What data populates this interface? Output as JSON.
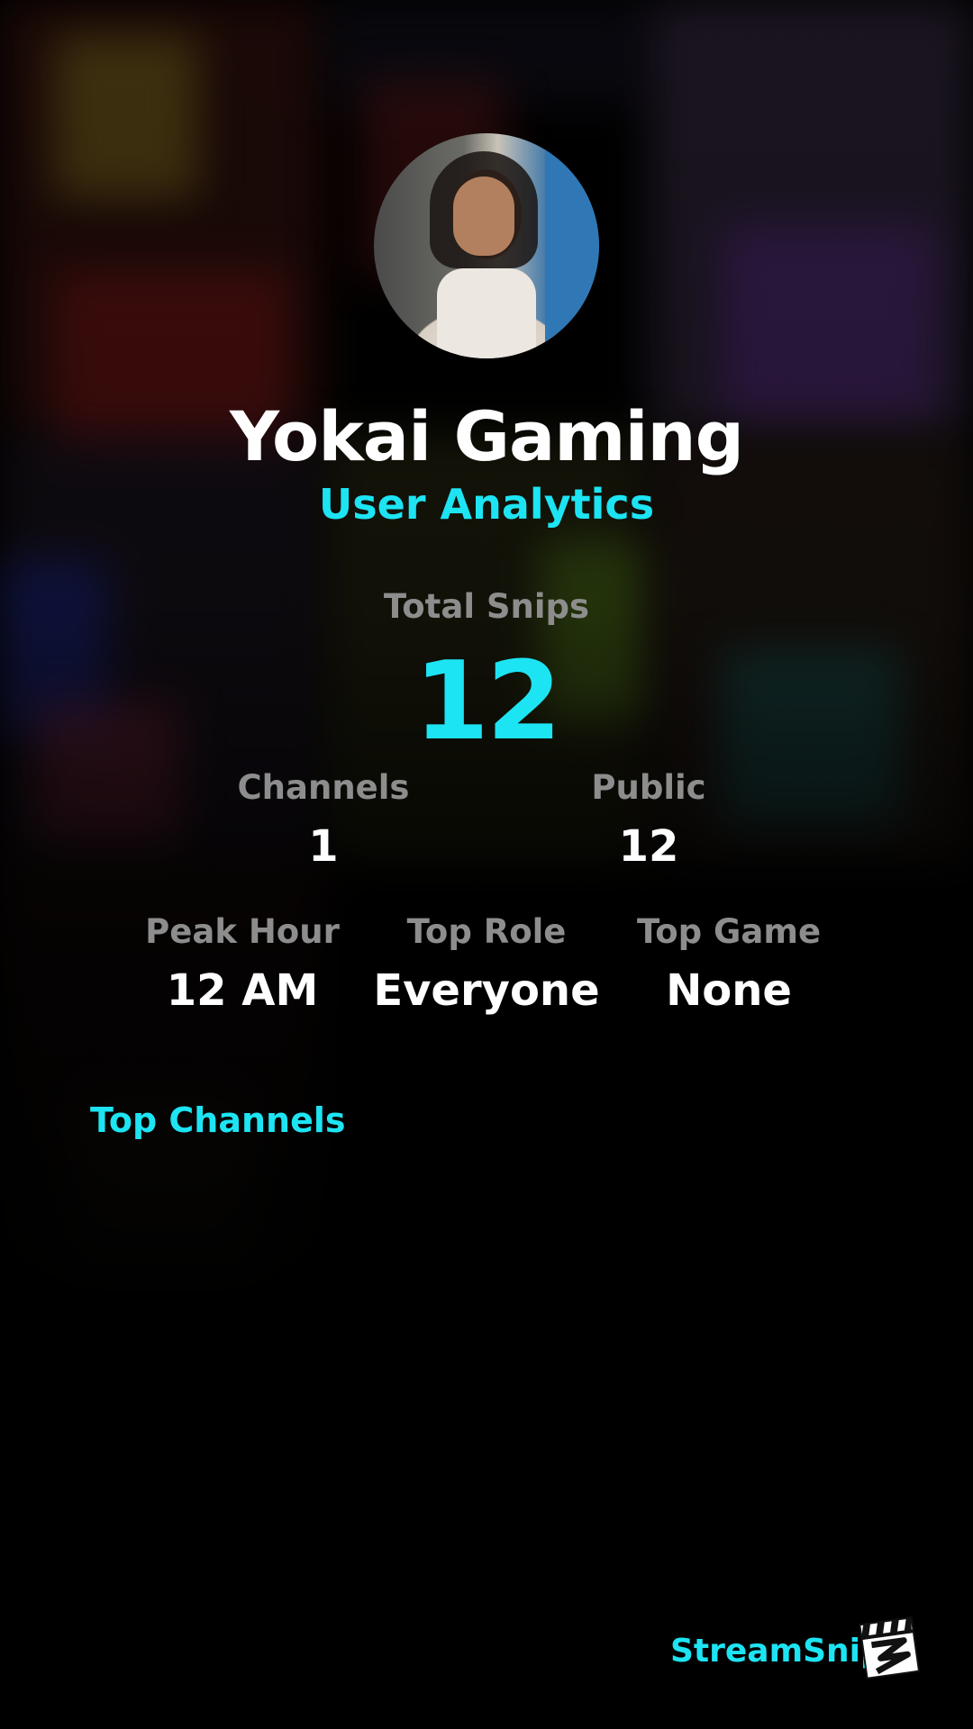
{
  "profile": {
    "name": "Yokai Gaming",
    "subtitle": "User Analytics"
  },
  "stats": {
    "total_snips_label": "Total Snips",
    "total_snips_value": "12",
    "channels_label": "Channels",
    "channels_value": "1",
    "public_label": "Public",
    "public_value": "12",
    "peak_hour_label": "Peak Hour",
    "peak_hour_value": "12 AM",
    "top_role_label": "Top Role",
    "top_role_value": "Everyone",
    "top_game_label": "Top Game",
    "top_game_value": "None"
  },
  "sections": {
    "top_channels_title": "Top Channels"
  },
  "brand": {
    "name": "StreamSnip",
    "logo_icon": "clapperboard-icon"
  },
  "colors": {
    "accent": "#1de4f3",
    "label": "#8d8d8d",
    "background": "#000000"
  }
}
